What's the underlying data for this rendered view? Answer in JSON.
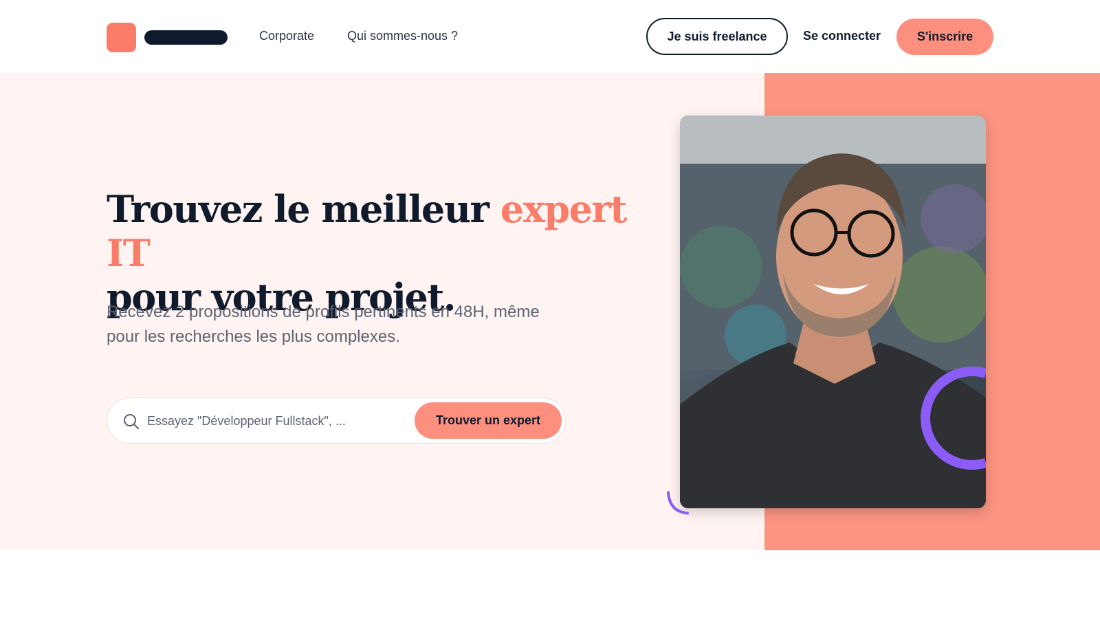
{
  "header": {
    "nav": {
      "corporate": "Corporate",
      "about": "Qui sommes-nous ?"
    },
    "freelance_button": "Je suis freelance",
    "login_link": "Se connecter",
    "signup_button": "S'inscrire"
  },
  "hero": {
    "headline_part1": "Trouvez le meilleur ",
    "headline_accent": "expert IT",
    "headline_part2": "pour votre projet.",
    "subtext": "Recevez 2 propositions de profils pertinents en 48H, même pour les recherches les plus complexes.",
    "search": {
      "placeholder": "Essayez \"Développeur Fullstack\", ...",
      "value": ""
    },
    "find_button": "Trouver un expert"
  },
  "icons": {
    "search": "search-icon",
    "logo": "logo-mark"
  },
  "colors": {
    "brand": "#fc8f7d",
    "dark": "#0f1b2d",
    "hero_bg": "#fff4f2",
    "decor_purple": "#8b5cf6"
  }
}
